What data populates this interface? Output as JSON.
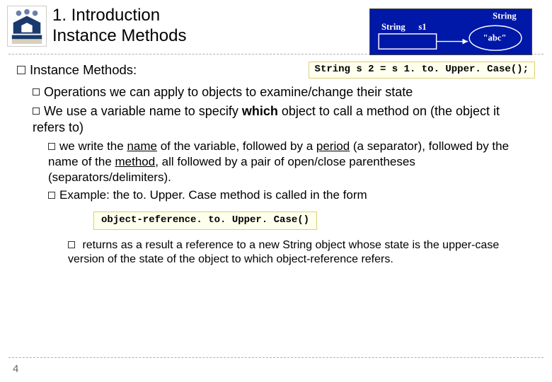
{
  "header": {
    "title_line1": "1. Introduction",
    "title_line2": "Instance Methods"
  },
  "diagram": {
    "label_string_type": "String",
    "label_var": "s1",
    "label_string_top": "String",
    "label_value": "\"abc\""
  },
  "heading": {
    "text": "Instance Methods:",
    "code": "String s 2 = s 1. to. Upper. Case();"
  },
  "bullets": {
    "b1_prefix": "Operations",
    "b1_rest": " we can apply to objects to examine/change their state",
    "b2_prefix": "We",
    "b2_rest_a": " use a variable name to specify ",
    "b2_bold": "which",
    "b2_rest_b": " object to call a method on (the object it refers to)",
    "b3_prefix": "we",
    "b3_rest_a": " write the ",
    "b3_u1": "name",
    "b3_rest_b": " of the variable, followed by a ",
    "b3_u2": "period",
    "b3_rest_c": " (a separator), followed by the name of the ",
    "b3_u3": "method",
    "b3_rest_d": ", all followed by a pair of open/close parentheses (separators/delimiters).",
    "b4_prefix": "Example:",
    "b4_rest": "  the to. Upper. Case method is called in the form",
    "code2": "object-reference. to. Upper. Case()",
    "b5": "returns as a result a reference to a new String object whose state is the upper-case version of the state of the object to which object-reference refers."
  },
  "page_number": "4"
}
